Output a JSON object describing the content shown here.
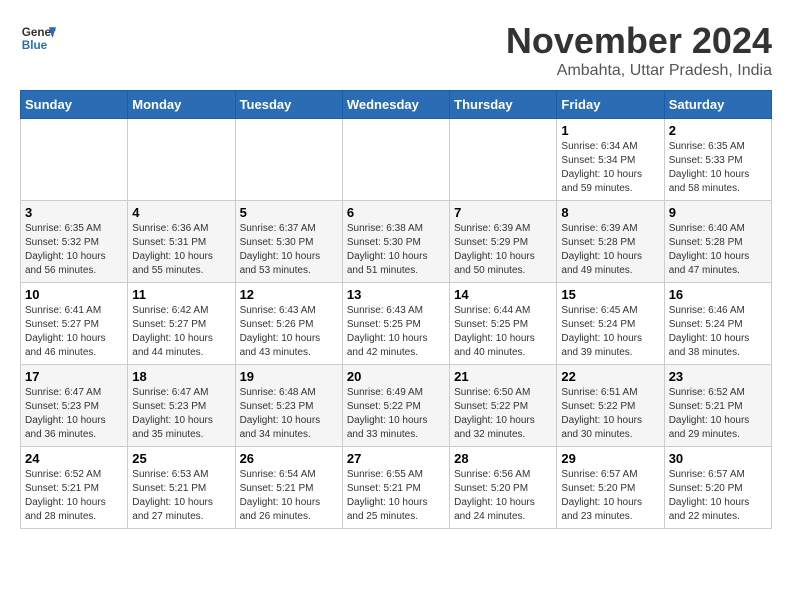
{
  "header": {
    "logo_general": "General",
    "logo_blue": "Blue",
    "title": "November 2024",
    "subtitle": "Ambahta, Uttar Pradesh, India"
  },
  "weekdays": [
    "Sunday",
    "Monday",
    "Tuesday",
    "Wednesday",
    "Thursday",
    "Friday",
    "Saturday"
  ],
  "weeks": [
    [
      {
        "day": "",
        "info": ""
      },
      {
        "day": "",
        "info": ""
      },
      {
        "day": "",
        "info": ""
      },
      {
        "day": "",
        "info": ""
      },
      {
        "day": "",
        "info": ""
      },
      {
        "day": "1",
        "info": "Sunrise: 6:34 AM\nSunset: 5:34 PM\nDaylight: 10 hours and 59 minutes."
      },
      {
        "day": "2",
        "info": "Sunrise: 6:35 AM\nSunset: 5:33 PM\nDaylight: 10 hours and 58 minutes."
      }
    ],
    [
      {
        "day": "3",
        "info": "Sunrise: 6:35 AM\nSunset: 5:32 PM\nDaylight: 10 hours and 56 minutes."
      },
      {
        "day": "4",
        "info": "Sunrise: 6:36 AM\nSunset: 5:31 PM\nDaylight: 10 hours and 55 minutes."
      },
      {
        "day": "5",
        "info": "Sunrise: 6:37 AM\nSunset: 5:30 PM\nDaylight: 10 hours and 53 minutes."
      },
      {
        "day": "6",
        "info": "Sunrise: 6:38 AM\nSunset: 5:30 PM\nDaylight: 10 hours and 51 minutes."
      },
      {
        "day": "7",
        "info": "Sunrise: 6:39 AM\nSunset: 5:29 PM\nDaylight: 10 hours and 50 minutes."
      },
      {
        "day": "8",
        "info": "Sunrise: 6:39 AM\nSunset: 5:28 PM\nDaylight: 10 hours and 49 minutes."
      },
      {
        "day": "9",
        "info": "Sunrise: 6:40 AM\nSunset: 5:28 PM\nDaylight: 10 hours and 47 minutes."
      }
    ],
    [
      {
        "day": "10",
        "info": "Sunrise: 6:41 AM\nSunset: 5:27 PM\nDaylight: 10 hours and 46 minutes."
      },
      {
        "day": "11",
        "info": "Sunrise: 6:42 AM\nSunset: 5:27 PM\nDaylight: 10 hours and 44 minutes."
      },
      {
        "day": "12",
        "info": "Sunrise: 6:43 AM\nSunset: 5:26 PM\nDaylight: 10 hours and 43 minutes."
      },
      {
        "day": "13",
        "info": "Sunrise: 6:43 AM\nSunset: 5:25 PM\nDaylight: 10 hours and 42 minutes."
      },
      {
        "day": "14",
        "info": "Sunrise: 6:44 AM\nSunset: 5:25 PM\nDaylight: 10 hours and 40 minutes."
      },
      {
        "day": "15",
        "info": "Sunrise: 6:45 AM\nSunset: 5:24 PM\nDaylight: 10 hours and 39 minutes."
      },
      {
        "day": "16",
        "info": "Sunrise: 6:46 AM\nSunset: 5:24 PM\nDaylight: 10 hours and 38 minutes."
      }
    ],
    [
      {
        "day": "17",
        "info": "Sunrise: 6:47 AM\nSunset: 5:23 PM\nDaylight: 10 hours and 36 minutes."
      },
      {
        "day": "18",
        "info": "Sunrise: 6:47 AM\nSunset: 5:23 PM\nDaylight: 10 hours and 35 minutes."
      },
      {
        "day": "19",
        "info": "Sunrise: 6:48 AM\nSunset: 5:23 PM\nDaylight: 10 hours and 34 minutes."
      },
      {
        "day": "20",
        "info": "Sunrise: 6:49 AM\nSunset: 5:22 PM\nDaylight: 10 hours and 33 minutes."
      },
      {
        "day": "21",
        "info": "Sunrise: 6:50 AM\nSunset: 5:22 PM\nDaylight: 10 hours and 32 minutes."
      },
      {
        "day": "22",
        "info": "Sunrise: 6:51 AM\nSunset: 5:22 PM\nDaylight: 10 hours and 30 minutes."
      },
      {
        "day": "23",
        "info": "Sunrise: 6:52 AM\nSunset: 5:21 PM\nDaylight: 10 hours and 29 minutes."
      }
    ],
    [
      {
        "day": "24",
        "info": "Sunrise: 6:52 AM\nSunset: 5:21 PM\nDaylight: 10 hours and 28 minutes."
      },
      {
        "day": "25",
        "info": "Sunrise: 6:53 AM\nSunset: 5:21 PM\nDaylight: 10 hours and 27 minutes."
      },
      {
        "day": "26",
        "info": "Sunrise: 6:54 AM\nSunset: 5:21 PM\nDaylight: 10 hours and 26 minutes."
      },
      {
        "day": "27",
        "info": "Sunrise: 6:55 AM\nSunset: 5:21 PM\nDaylight: 10 hours and 25 minutes."
      },
      {
        "day": "28",
        "info": "Sunrise: 6:56 AM\nSunset: 5:20 PM\nDaylight: 10 hours and 24 minutes."
      },
      {
        "day": "29",
        "info": "Sunrise: 6:57 AM\nSunset: 5:20 PM\nDaylight: 10 hours and 23 minutes."
      },
      {
        "day": "30",
        "info": "Sunrise: 6:57 AM\nSunset: 5:20 PM\nDaylight: 10 hours and 22 minutes."
      }
    ]
  ]
}
